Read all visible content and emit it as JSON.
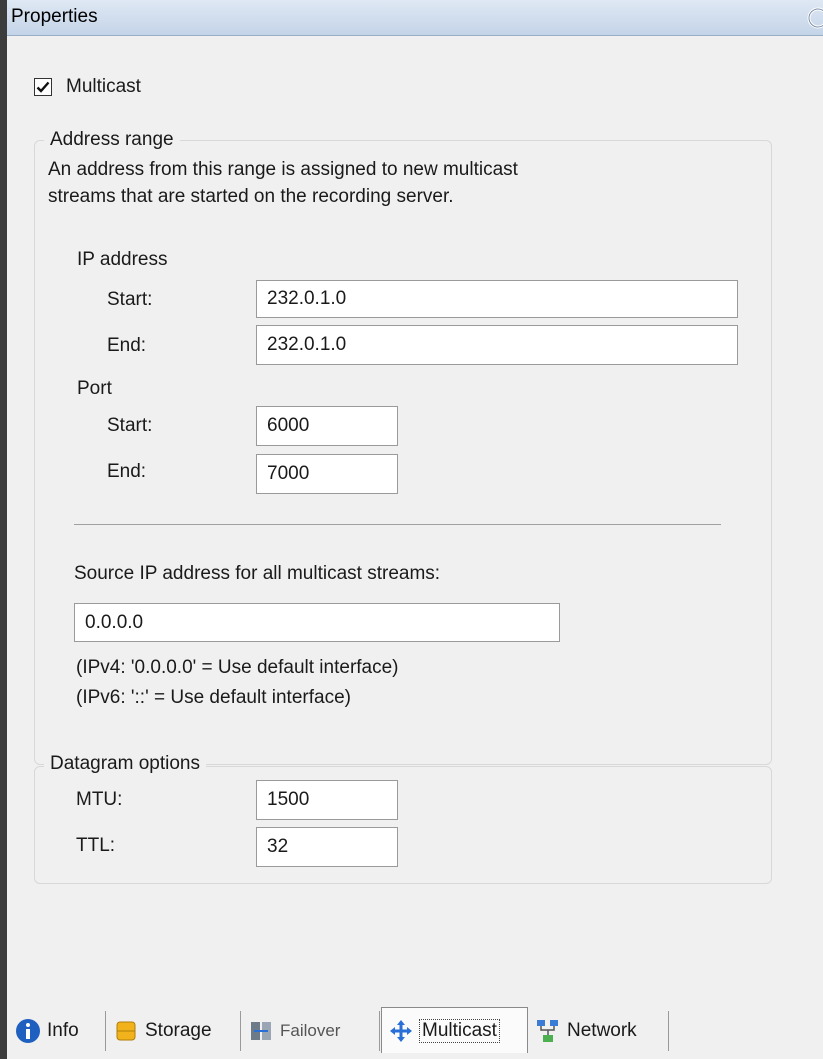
{
  "window": {
    "title": "Properties"
  },
  "multicast_checkbox": {
    "label": "Multicast",
    "checked": true
  },
  "address_range": {
    "legend": "Address range",
    "description_line1": "An address from this range is assigned to new multicast",
    "description_line2": "streams that are started on the recording server.",
    "ip_address": {
      "heading": "IP address",
      "start_label": "Start:",
      "start_value": "232.0.1.0",
      "end_label": "End:",
      "end_value": "232.0.1.0"
    },
    "port": {
      "heading": "Port",
      "start_label": "Start:",
      "start_value": "6000",
      "end_label": "End:",
      "end_value": "7000"
    },
    "source_ip": {
      "label": "Source IP address for all multicast streams:",
      "value": "0.0.0.0",
      "hint_ipv4": "(IPv4: '0.0.0.0' = Use default interface)",
      "hint_ipv6": "(IPv6: '::' = Use default interface)"
    }
  },
  "datagram_options": {
    "legend": "Datagram options",
    "mtu_label": "MTU:",
    "mtu_value": "1500",
    "ttl_label": "TTL:",
    "ttl_value": "32"
  },
  "tabs": [
    {
      "label": "Info",
      "icon": "info-icon",
      "active": false
    },
    {
      "label": "Storage",
      "icon": "storage-icon",
      "active": false
    },
    {
      "label": "Failover",
      "icon": "failover-icon",
      "active": false
    },
    {
      "label": "Multicast",
      "icon": "multicast-icon",
      "active": true
    },
    {
      "label": "Network",
      "icon": "network-icon",
      "active": false
    }
  ],
  "colors": {
    "title_bar": "#c4d4e8",
    "panel_background": "#f0f0f0",
    "info_icon": "#1f5fbf",
    "storage_icon": "#f2b21b",
    "multicast_icon": "#2a6fd6"
  }
}
